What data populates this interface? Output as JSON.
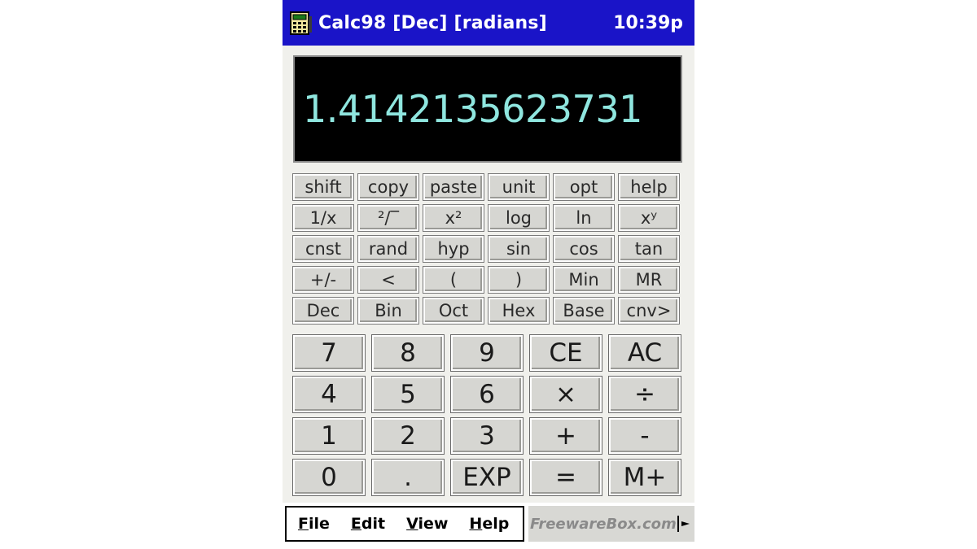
{
  "titlebar": {
    "title": "Calc98 [Dec] [radians]",
    "clock": "10:39p"
  },
  "display": {
    "value": "1.4142135623731"
  },
  "function_keys": [
    [
      "shift",
      "copy",
      "paste",
      "unit",
      "opt",
      "help"
    ],
    [
      "1/x",
      "²/‾",
      "x²",
      "log",
      "ln",
      "xʸ"
    ],
    [
      "cnst",
      "rand",
      "hyp",
      "sin",
      "cos",
      "tan"
    ],
    [
      "+/-",
      "<",
      "(",
      ")",
      "Min",
      "MR"
    ],
    [
      "Dec",
      "Bin",
      "Oct",
      "Hex",
      "Base",
      "cnv>"
    ]
  ],
  "main_keys": [
    [
      "7",
      "8",
      "9",
      "CE",
      "AC"
    ],
    [
      "4",
      "5",
      "6",
      "×",
      "÷"
    ],
    [
      "1",
      "2",
      "3",
      "+",
      "-"
    ],
    [
      "0",
      ".",
      "EXP",
      "=",
      "M+"
    ]
  ],
  "menubar": {
    "items": [
      "File",
      "Edit",
      "View",
      "Help"
    ],
    "watermark": "FreewareBox.com"
  },
  "icons": {
    "app": "calculator-icon",
    "keyboard": "keyboard-toggle-icon"
  },
  "colors": {
    "titlebar": "#1a14c8",
    "display_bg": "#000000",
    "display_text": "#8fe6df",
    "key_face": "#d6d6d2"
  }
}
